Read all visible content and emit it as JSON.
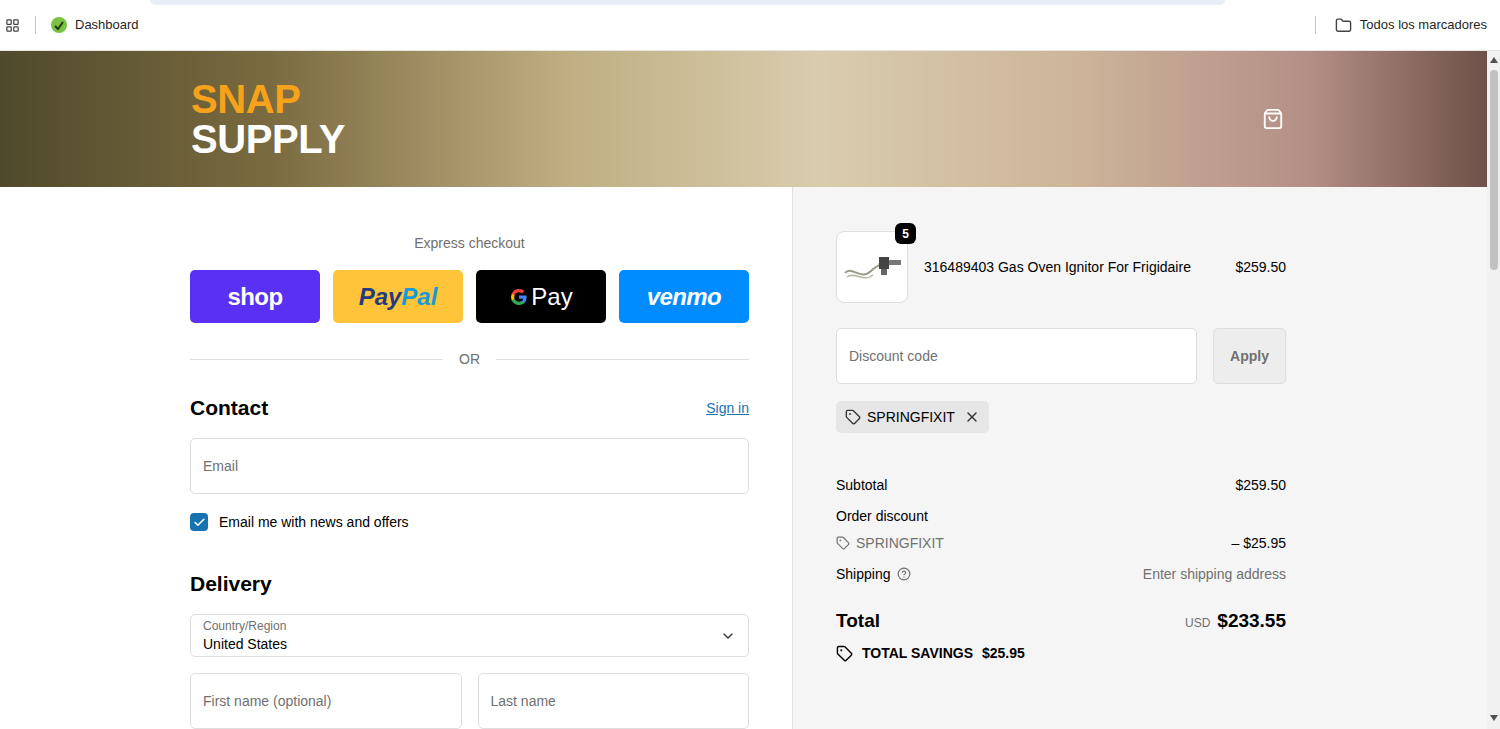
{
  "browser": {
    "bookmarks": [
      {
        "label": "Dashboard"
      }
    ],
    "all_bookmarks": "Todos los marcadores"
  },
  "header": {
    "logo": [
      "SNAP",
      "SUPPLY"
    ]
  },
  "express_checkout": {
    "label": "Express checkout",
    "buttons": [
      {
        "kind": "shop",
        "parts": [
          "shop"
        ],
        "color": "#5a31f4"
      },
      {
        "kind": "paypal",
        "parts": [
          "Pay",
          "Pal"
        ],
        "color": "#ffc439"
      },
      {
        "kind": "gpay",
        "parts": [
          "Pay"
        ],
        "color": "#000000"
      },
      {
        "kind": "venmo",
        "parts": [
          "venmo"
        ],
        "color": "#008cff"
      }
    ]
  },
  "divider": "OR",
  "contact": {
    "title": "Contact",
    "sign_in": "Sign in",
    "email_placeholder": "Email",
    "newsletter": {
      "label": "Email me with news and offers",
      "checked": true
    }
  },
  "delivery": {
    "title": "Delivery",
    "country": {
      "label": "Country/Region",
      "value": "United States"
    },
    "first_name_placeholder": "First name (optional)",
    "last_name_placeholder": "Last name"
  },
  "cart": {
    "items": [
      {
        "quantity": "5",
        "name": "316489403 Gas Oven Ignitor For Frigidaire",
        "price": "$259.50"
      }
    ],
    "discount": {
      "placeholder": "Discount code",
      "apply": "Apply",
      "applied": [
        "SPRINGFIXIT"
      ]
    },
    "summary": {
      "subtotal_label": "Subtotal",
      "subtotal": "$259.50",
      "order_discount_label": "Order discount",
      "discounts": [
        {
          "code": "SPRINGFIXIT",
          "amount": "– $25.95"
        }
      ],
      "shipping_label": "Shipping",
      "shipping": "Enter shipping address",
      "total_label": "Total",
      "currency": "USD",
      "total": "$233.55",
      "savings_label": "TOTAL SAVINGS",
      "savings": "$25.95"
    }
  }
}
